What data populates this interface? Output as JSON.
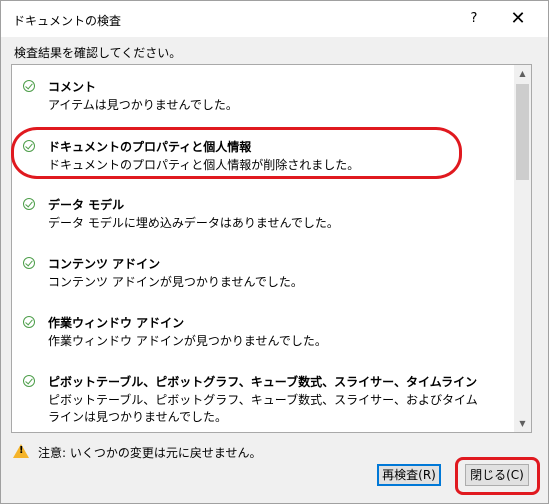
{
  "window": {
    "title": "ドキュメントの検査",
    "help_glyph": "?",
    "close_glyph": "✕"
  },
  "instruction": "検査結果を確認してください。",
  "results": [
    {
      "title": "コメント",
      "description": "アイテムは見つかりませんでした。",
      "status": "check-icon"
    },
    {
      "title": "ドキュメントのプロパティと個人情報",
      "description": "ドキュメントのプロパティと個人情報が削除されました。",
      "status": "check-icon"
    },
    {
      "title": "データ モデル",
      "description": "データ モデルに埋め込みデータはありませんでした。",
      "status": "check-icon"
    },
    {
      "title": "コンテンツ アドイン",
      "description": "コンテンツ アドインが見つかりませんでした。",
      "status": "check-icon"
    },
    {
      "title": "作業ウィンドウ アドイン",
      "description": "作業ウィンドウ アドインが見つかりませんでした。",
      "status": "check-icon"
    },
    {
      "title": "ピボットテーブル、ピボットグラフ、キューブ数式、スライサー、タイムライン",
      "description": "ピボットテーブル、ピボットグラフ、キューブ数式、スライサー、およびタイムラインは見つかりませんでした。",
      "status": "check-icon"
    }
  ],
  "warning": {
    "text": "注意: いくつかの変更は元に戻せません。",
    "icon": "warning-icon"
  },
  "buttons": {
    "recheck": "再検査(R)",
    "close": "閉じる(C)"
  },
  "colors": {
    "check": "#4d9e4a",
    "highlight": "#e0191f",
    "warning": "#f5b42a",
    "focus_border": "#0078d7"
  }
}
